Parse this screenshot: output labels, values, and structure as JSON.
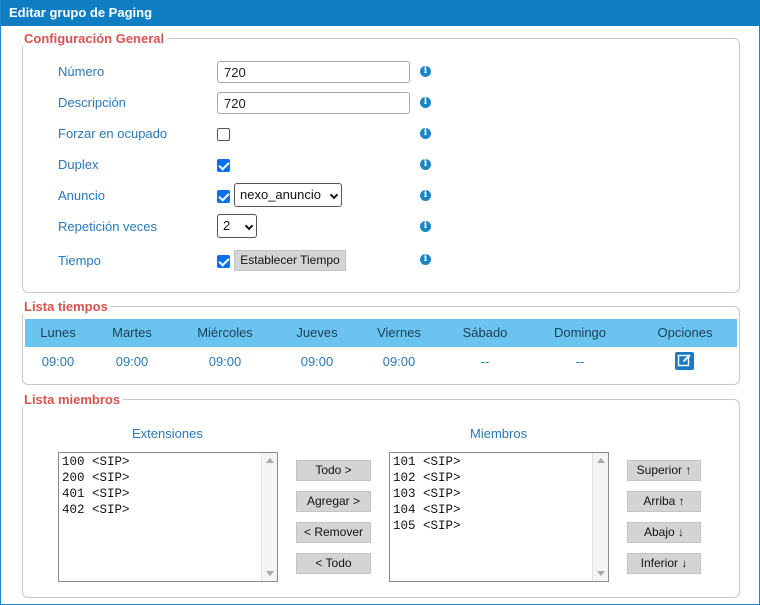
{
  "title": "Editar grupo de Paging",
  "general": {
    "legend": "Configuración General",
    "numero_label": "Número",
    "numero_value": "720",
    "descripcion_label": "Descripción",
    "descripcion_value": "720",
    "forzar_label": "Forzar en ocupado",
    "forzar_checked": false,
    "duplex_label": "Duplex",
    "duplex_checked": true,
    "anuncio_label": "Anuncio",
    "anuncio_checked": true,
    "anuncio_selected": "nexo_anuncio",
    "repeticion_label": "Repetición veces",
    "repeticion_selected": "2",
    "tiempo_label": "Tiempo",
    "tiempo_checked": true,
    "tiempo_button": "Establecer Tiempo",
    "info_glyph": "i"
  },
  "tiempos": {
    "legend": "Lista tiempos",
    "headers": [
      "Lunes",
      "Martes",
      "Miércoles",
      "Jueves",
      "Viernes",
      "Sábado",
      "Domingo",
      "Opciones"
    ],
    "row": [
      "09:00",
      "09:00",
      "09:00",
      "09:00",
      "09:00",
      "--",
      "--"
    ],
    "edit_icon": "edit-icon"
  },
  "miembros": {
    "legend": "Lista miembros",
    "extensiones_label": "Extensiones",
    "miembros_label": "Miembros",
    "extensiones": [
      "100 <SIP>",
      "200 <SIP>",
      "401 <SIP>",
      "402 <SIP>"
    ],
    "miembros": [
      "101 <SIP>",
      "102 <SIP>",
      "103 <SIP>",
      "104 <SIP>",
      "105 <SIP>"
    ],
    "btn_todo_add": "Todo >",
    "btn_agregar": "Agregar >",
    "btn_remover": "< Remover",
    "btn_todo_remove": "< Todo",
    "btn_superior": "Superior ↑",
    "btn_arriba": "Arriba ↑",
    "btn_abajo": "Abajo ↓",
    "btn_inferior": "Inferior ↓"
  },
  "colors": {
    "titlebar": "#0f7dc2",
    "legend": "#d9534f",
    "label": "#2a78b8",
    "table_header": "#6bc4ef",
    "checkbox": "#0a72e6"
  }
}
